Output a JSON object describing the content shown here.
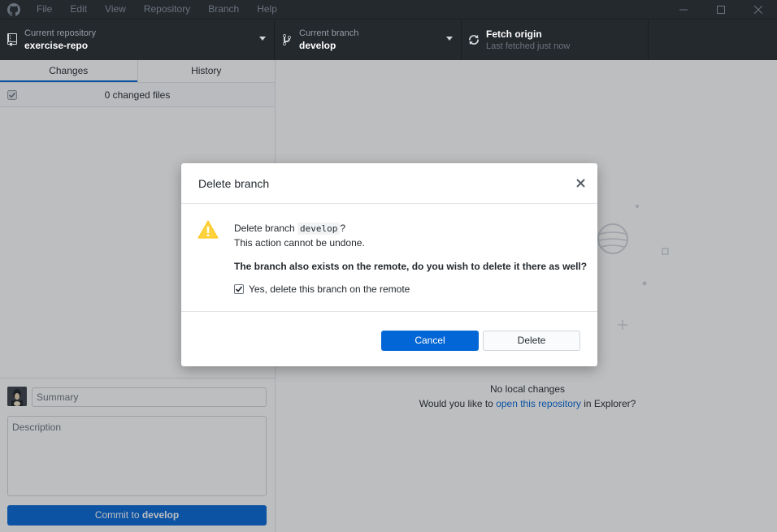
{
  "titlebar": {
    "menu": [
      "File",
      "Edit",
      "View",
      "Repository",
      "Branch",
      "Help"
    ]
  },
  "toolbar": {
    "repo_label": "Current repository",
    "repo_value": "exercise-repo",
    "branch_label": "Current branch",
    "branch_value": "develop",
    "fetch_title": "Fetch origin",
    "fetch_sub": "Last fetched just now"
  },
  "sidebar": {
    "tabs": [
      "Changes",
      "History"
    ],
    "changed_files": "0 changed files",
    "summary_placeholder": "Summary",
    "description_placeholder": "Description",
    "commit_prefix": "Commit to ",
    "commit_branch": "develop"
  },
  "main": {
    "no_changes": "No local changes",
    "prompt_before": "Would you like to ",
    "prompt_link": "open this repository",
    "prompt_after": " in Explorer?"
  },
  "dialog": {
    "title": "Delete branch",
    "line1_prefix": "Delete branch ",
    "branch": "develop",
    "line1_suffix": "?",
    "line2": "This action cannot be undone.",
    "question": "The branch also exists on the remote, do you wish to delete it there as well?",
    "checkbox_label": "Yes, delete this branch on the remote",
    "checkbox_checked": true,
    "cancel": "Cancel",
    "delete": "Delete"
  },
  "colors": {
    "accent": "#0366d6",
    "toolbar_bg": "#24292e",
    "warning": "#ffd33d"
  }
}
